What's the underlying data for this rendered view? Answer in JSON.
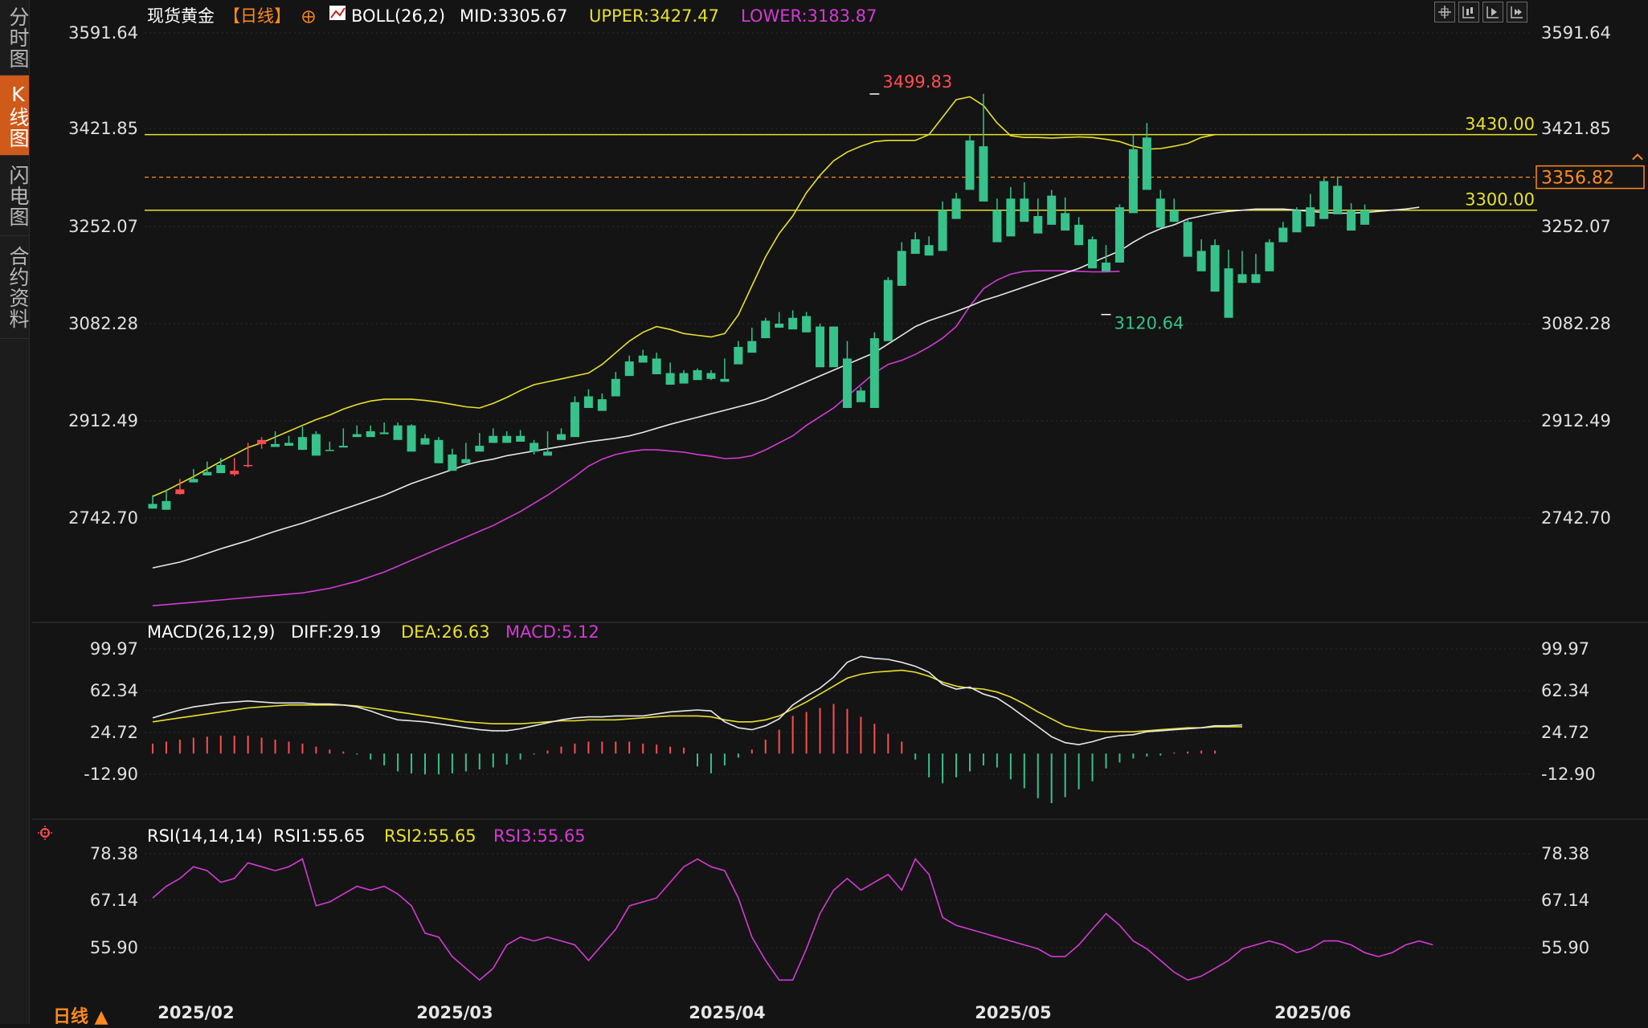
{
  "sidebar": {
    "tabs": [
      {
        "label": "分时图",
        "active": false
      },
      {
        "label": "K线图",
        "active": true
      },
      {
        "label": "闪电图",
        "active": false
      },
      {
        "label": "合约资料",
        "active": false
      }
    ]
  },
  "toolbar": {
    "icons": [
      "crosshair-icon",
      "candle-layout-icon",
      "chart-play-icon",
      "chart-forward-icon"
    ]
  },
  "header": {
    "symbol": "现货黄金",
    "period_tag": "【日线】",
    "indicator_name": "BOLL(26,2)",
    "mid": "MID:3305.67",
    "upper": "UPPER:3427.47",
    "lower": "LOWER:3183.87"
  },
  "macd_header": {
    "name": "MACD(26,12,9)",
    "diff": "DIFF:29.19",
    "dea": "DEA:26.63",
    "macd": "MACD:5.12"
  },
  "rsi_header": {
    "name": "RSI(14,14,14)",
    "rsi1": "RSI1:55.65",
    "rsi2": "RSI2:55.65",
    "rsi3": "RSI3:55.65"
  },
  "period_label": "日线 ▲",
  "colors": {
    "up": "#ff4d4f",
    "down": "#36c28a",
    "mid": "#e8e8e8",
    "upper": "#e8e02a",
    "lower": "#d43ad4",
    "hline": "#e8e02a",
    "price": "#ff8a1c",
    "grid": "#2e2e2e"
  },
  "chart_data": [
    {
      "type": "candlestick",
      "title": "现货黄金",
      "y_ticks": [
        "3591.64",
        "3421.85",
        "3252.07",
        "3082.28",
        "2912.49",
        "2742.70"
      ],
      "ylim": [
        2612,
        3620
      ],
      "x_ticks": [
        {
          "label": "2025/02",
          "index": 2
        },
        {
          "label": "2025/03",
          "index": 21
        },
        {
          "label": "2025/04",
          "index": 41
        },
        {
          "label": "2025/05",
          "index": 62
        },
        {
          "label": "2025/06",
          "index": 84
        }
      ],
      "horizontal_lines": [
        {
          "value": 3430.0,
          "label": "3430.00"
        },
        {
          "value": 3300.0,
          "label": "3300.00"
        }
      ],
      "current_price": {
        "value": 3356.82,
        "label": "3356.82"
      },
      "annotations": [
        {
          "label": "3499.83",
          "value": 3499.83,
          "index": 53
        },
        {
          "label": "3120.64",
          "value": 3120.64,
          "index": 70
        }
      ],
      "candles": [
        [
          2795,
          2810,
          2790,
          2787
        ],
        [
          2800,
          2820,
          2797,
          2785
        ],
        [
          2812,
          2838,
          2811,
          2820
        ],
        [
          2838,
          2855,
          2836,
          2832
        ],
        [
          2850,
          2868,
          2848,
          2844
        ],
        [
          2862,
          2874,
          2857,
          2848
        ],
        [
          2846,
          2874,
          2843,
          2852
        ],
        [
          2862,
          2900,
          2858,
          2862
        ],
        [
          2898,
          2910,
          2890,
          2905
        ],
        [
          2898,
          2920,
          2896,
          2893
        ],
        [
          2900,
          2912,
          2898,
          2895
        ],
        [
          2910,
          2928,
          2904,
          2888
        ],
        [
          2915,
          2920,
          2880,
          2878
        ],
        [
          2888,
          2902,
          2888,
          2886
        ],
        [
          2895,
          2925,
          2895,
          2892
        ],
        [
          2915,
          2930,
          2912,
          2910
        ],
        [
          2920,
          2930,
          2915,
          2910
        ],
        [
          2918,
          2935,
          2915,
          2915
        ],
        [
          2930,
          2935,
          2910,
          2905
        ],
        [
          2930,
          2932,
          2895,
          2885
        ],
        [
          2908,
          2915,
          2898,
          2897
        ],
        [
          2905,
          2910,
          2868,
          2865
        ],
        [
          2880,
          2890,
          2862,
          2852
        ],
        [
          2872,
          2900,
          2870,
          2865
        ],
        [
          2895,
          2917,
          2892,
          2885
        ],
        [
          2912,
          2925,
          2900,
          2900
        ],
        [
          2912,
          2920,
          2908,
          2900
        ],
        [
          2912,
          2922,
          2908,
          2902
        ],
        [
          2900,
          2905,
          2880,
          2885
        ],
        [
          2885,
          2920,
          2885,
          2878
        ],
        [
          2915,
          2925,
          2908,
          2905
        ],
        [
          2970,
          2980,
          2920,
          2910
        ],
        [
          2980,
          2992,
          2965,
          2960
        ],
        [
          2975,
          2985,
          2960,
          2955
        ],
        [
          3010,
          3022,
          2985,
          2980
        ],
        [
          3040,
          3050,
          3020,
          3015
        ],
        [
          3050,
          3060,
          3040,
          3038
        ],
        [
          3045,
          3055,
          3020,
          3018
        ],
        [
          3020,
          3038,
          3000,
          3000
        ],
        [
          3020,
          3025,
          3005,
          3002
        ],
        [
          3025,
          3028,
          3010,
          3008
        ],
        [
          3020,
          3025,
          3008,
          3010
        ],
        [
          3010,
          3045,
          3008,
          3005
        ],
        [
          3065,
          3075,
          3040,
          3035
        ],
        [
          3075,
          3098,
          3055,
          3055
        ],
        [
          3110,
          3115,
          3085,
          3080
        ],
        [
          3105,
          3125,
          3100,
          3098
        ],
        [
          3115,
          3128,
          3098,
          3095
        ],
        [
          3118,
          3125,
          3090,
          3090
        ],
        [
          3100,
          3105,
          3035,
          3030
        ],
        [
          3100,
          3100,
          3050,
          3030
        ],
        [
          3045,
          3075,
          2970,
          2960
        ],
        [
          2990,
          2996,
          2985,
          2970
        ],
        [
          3080,
          3090,
          2970,
          2960
        ],
        [
          3180,
          3185,
          3080,
          3075
        ],
        [
          3230,
          3245,
          3175,
          3170
        ],
        [
          3250,
          3262,
          3230,
          3225
        ],
        [
          3240,
          3255,
          3225,
          3222
        ],
        [
          3300,
          3315,
          3235,
          3230
        ],
        [
          3320,
          3330,
          3290,
          3285
        ],
        [
          3420,
          3430,
          3340,
          3335
        ],
        [
          3410,
          3500,
          3320,
          3315
        ],
        [
          3300,
          3320,
          3250,
          3245
        ],
        [
          3320,
          3340,
          3260,
          3255
        ],
        [
          3320,
          3348,
          3285,
          3280
        ],
        [
          3290,
          3320,
          3265,
          3260
        ],
        [
          3325,
          3335,
          3280,
          3275
        ],
        [
          3295,
          3322,
          3270,
          3265
        ],
        [
          3275,
          3288,
          3240,
          3240
        ],
        [
          3250,
          3255,
          3205,
          3200
        ],
        [
          3210,
          3240,
          3200,
          3195
        ],
        [
          3305,
          3310,
          3215,
          3210
        ],
        [
          3405,
          3430,
          3300,
          3295
        ],
        [
          3425,
          3450,
          3340,
          3335
        ],
        [
          3320,
          3335,
          3275,
          3270
        ],
        [
          3300,
          3320,
          3285,
          3280
        ],
        [
          3280,
          3285,
          3225,
          3220
        ],
        [
          3230,
          3250,
          3200,
          3195
        ],
        [
          3240,
          3250,
          3160,
          3160
        ],
        [
          3200,
          3232,
          3120,
          3115
        ],
        [
          3190,
          3230,
          3180,
          3175
        ],
        [
          3190,
          3225,
          3180,
          3175
        ],
        [
          3245,
          3250,
          3200,
          3195
        ],
        [
          3270,
          3280,
          3245,
          3245
        ],
        [
          3300,
          3305,
          3268,
          3262
        ],
        [
          3305,
          3328,
          3280,
          3272
        ],
        [
          3350,
          3355,
          3290,
          3285
        ],
        [
          3342,
          3358,
          3300,
          3293
        ],
        [
          3300,
          3312,
          3270,
          3265
        ],
        [
          3300,
          3310,
          3280,
          3275
        ]
      ],
      "mid_band": [
        2685,
        2690,
        2695,
        2702,
        2710,
        2718,
        2725,
        2732,
        2740,
        2748,
        2755,
        2762,
        2770,
        2778,
        2786,
        2794,
        2802,
        2810,
        2820,
        2830,
        2838,
        2846,
        2854,
        2862,
        2868,
        2872,
        2878,
        2882,
        2886,
        2890,
        2894,
        2898,
        2902,
        2905,
        2908,
        2912,
        2918,
        2925,
        2932,
        2938,
        2944,
        2950,
        2956,
        2962,
        2968,
        2975,
        2985,
        2995,
        3005,
        3015,
        3025,
        3035,
        3045,
        3055,
        3070,
        3085,
        3100,
        3110,
        3118,
        3126,
        3135,
        3145,
        3152,
        3160,
        3168,
        3176,
        3184,
        3192,
        3200,
        3210,
        3220,
        3230,
        3245,
        3258,
        3268,
        3275,
        3285,
        3290,
        3295,
        3298,
        3300,
        3302,
        3302,
        3302,
        3300,
        3298,
        3296,
        3295,
        3295,
        3296,
        3298,
        3300,
        3302,
        3305
      ],
      "upper_band": [
        2808,
        2818,
        2830,
        2842,
        2855,
        2868,
        2880,
        2892,
        2900,
        2910,
        2920,
        2930,
        2940,
        2948,
        2958,
        2966,
        2972,
        2975,
        2975,
        2975,
        2973,
        2970,
        2966,
        2962,
        2960,
        2968,
        2978,
        2990,
        3000,
        3005,
        3010,
        3015,
        3020,
        3035,
        3055,
        3075,
        3090,
        3100,
        3095,
        3088,
        3085,
        3082,
        3088,
        3120,
        3170,
        3220,
        3260,
        3290,
        3330,
        3360,
        3385,
        3400,
        3410,
        3418,
        3420,
        3420,
        3420,
        3430,
        3460,
        3490,
        3495,
        3480,
        3450,
        3428,
        3425,
        3425,
        3424,
        3425,
        3426,
        3425,
        3422,
        3418,
        3410,
        3405,
        3406,
        3410,
        3415,
        3425,
        3430
      ],
      "lower_band": [
        2620,
        2622,
        2624,
        2626,
        2628,
        2630,
        2632,
        2634,
        2636,
        2638,
        2640,
        2642,
        2646,
        2650,
        2656,
        2662,
        2670,
        2678,
        2688,
        2698,
        2708,
        2718,
        2728,
        2738,
        2748,
        2758,
        2770,
        2782,
        2796,
        2810,
        2826,
        2842,
        2860,
        2872,
        2880,
        2885,
        2888,
        2888,
        2886,
        2884,
        2880,
        2877,
        2873,
        2874,
        2878,
        2888,
        2900,
        2912,
        2930,
        2945,
        2960,
        2980,
        3000,
        3020,
        3035,
        3042,
        3052,
        3065,
        3080,
        3100,
        3135,
        3165,
        3180,
        3190,
        3195,
        3196,
        3196,
        3196,
        3195,
        3194,
        3194,
        3195
      ]
    },
    {
      "type": "bar+line",
      "title": "MACD(26,12,9)",
      "y_ticks": [
        "99.97",
        "62.34",
        "24.72",
        "-12.90"
      ],
      "ylim": [
        -50,
        112
      ],
      "diff": [
        36,
        40,
        44,
        47,
        49,
        51,
        52,
        53,
        52,
        51,
        51,
        51,
        50,
        50,
        49,
        47,
        43,
        38,
        34,
        33,
        32,
        30,
        28,
        26,
        24,
        23,
        23,
        25,
        28,
        31,
        34,
        36,
        37,
        37,
        38,
        38,
        38,
        40,
        42,
        43,
        44,
        43,
        32,
        26,
        24,
        28,
        35,
        49,
        58,
        66,
        77,
        92,
        98,
        96,
        95,
        92,
        88,
        82,
        70,
        65,
        67,
        60,
        56,
        47,
        37,
        27,
        17,
        11,
        9,
        12,
        16,
        18,
        19,
        22,
        23,
        24,
        25,
        26,
        28,
        28,
        29
      ],
      "dea": [
        32,
        34,
        36,
        38,
        40,
        42,
        44,
        46,
        47,
        48,
        49,
        49,
        49,
        49,
        49,
        48,
        46,
        44,
        42,
        40,
        38,
        36,
        34,
        32,
        31,
        30,
        30,
        30,
        31,
        32,
        33,
        33,
        34,
        34,
        34,
        35,
        36,
        37,
        38,
        38,
        38,
        37,
        34,
        32,
        32,
        34,
        38,
        45,
        52,
        60,
        68,
        76,
        80,
        82,
        83,
        84,
        82,
        78,
        72,
        68,
        66,
        65,
        62,
        57,
        50,
        42,
        35,
        28,
        25,
        23,
        22,
        22,
        22,
        23,
        24,
        25,
        26,
        26,
        27,
        27,
        27
      ],
      "hist": [
        10,
        12,
        14,
        16,
        17,
        18,
        18,
        18,
        16,
        14,
        12,
        10,
        7,
        4,
        2,
        -1,
        -6,
        -12,
        -18,
        -20,
        -21,
        -21,
        -20,
        -18,
        -16,
        -14,
        -11,
        -6,
        -1,
        3,
        7,
        10,
        12,
        12,
        12,
        12,
        10,
        9,
        7,
        6,
        -13,
        -20,
        -12,
        -4,
        4,
        14,
        24,
        38,
        42,
        46,
        50,
        45,
        37,
        30,
        20,
        12,
        -6,
        -24,
        -30,
        -24,
        -18,
        -12,
        -14,
        -26,
        -35,
        -45,
        -50,
        -44,
        -36,
        -28,
        -15,
        -9,
        -5,
        -3,
        -2,
        1,
        2,
        3,
        3
      ]
    },
    {
      "type": "line",
      "title": "RSI(14,14,14)",
      "y_ticks": [
        "78.38",
        "67.14",
        "55.90"
      ],
      "ylim": [
        45,
        82
      ],
      "values": [
        68,
        71,
        73,
        76,
        75,
        72,
        73,
        77,
        76,
        75,
        76,
        78,
        66,
        67,
        69,
        71,
        70,
        71,
        69,
        66,
        59,
        58,
        53,
        50,
        47,
        50,
        56,
        58,
        57,
        58,
        57,
        56,
        52,
        56,
        60,
        66,
        67,
        68,
        72,
        76,
        78,
        76,
        75,
        68,
        58,
        52,
        47,
        47,
        55,
        64,
        70,
        73,
        70,
        72,
        74,
        70,
        78,
        74,
        63,
        61,
        60,
        59,
        58,
        57,
        56,
        55,
        53,
        53,
        56,
        60,
        64,
        61,
        57,
        55,
        52,
        49,
        47,
        48,
        50,
        52,
        55,
        56,
        57,
        56,
        54,
        55,
        57,
        57,
        56,
        54,
        53,
        54,
        56,
        57,
        56
      ]
    }
  ]
}
